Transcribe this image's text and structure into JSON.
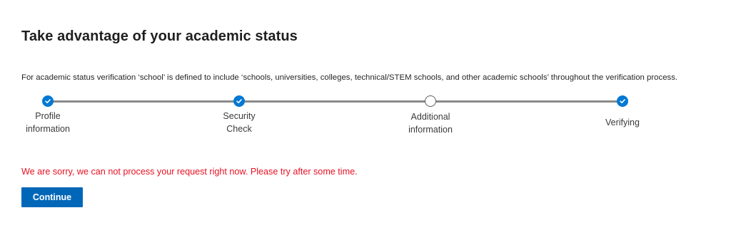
{
  "page": {
    "title": "Take advantage of your academic status",
    "intro": "For academic status verification ‘school’ is defined to include ‘schools, universities, colleges, technical/STEM schools, and other academic schools’ throughout the verification process."
  },
  "stepper": {
    "steps": [
      {
        "label": "Profile\ninformation",
        "status": "complete"
      },
      {
        "label": "Security\nCheck",
        "status": "complete"
      },
      {
        "label": "Additional\ninformation",
        "status": "pending"
      },
      {
        "label": "Verifying",
        "status": "complete"
      }
    ],
    "complete_icon": "checkmark-icon",
    "complete_color": "#0078d4",
    "connector_color": "#8a8a8a"
  },
  "error": {
    "message": "We are sorry, we can not process your request right now. Please try after some time.",
    "color": "#e81123"
  },
  "actions": {
    "continue_label": "Continue",
    "continue_color": "#0067b8"
  }
}
